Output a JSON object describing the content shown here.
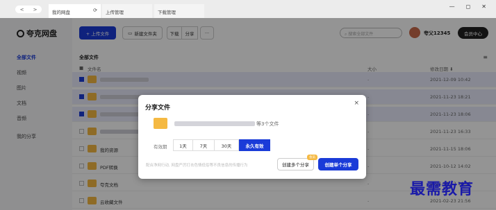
{
  "browser": {
    "nav": [
      "<",
      ">"
    ],
    "tabs": [
      "我的网盘",
      "上传管理",
      "下载管理"
    ],
    "refresh": "⟳",
    "window_controls": [
      "—",
      "◻",
      "✕"
    ]
  },
  "sidebar": {
    "logo": "夸克网盘",
    "items": [
      {
        "label": "全部文件",
        "active": true
      },
      {
        "label": "视频"
      },
      {
        "label": "图片"
      },
      {
        "label": "文档"
      },
      {
        "label": "音频"
      },
      {
        "label": "我的分享"
      }
    ]
  },
  "toolbar": {
    "upload": "+ 上传文件",
    "new_folder": "新建文件夹",
    "download": "下载",
    "share": "分享",
    "more": "···",
    "search_placeholder": "搜索全部文件",
    "username": "夸父12345",
    "vip": "会员中心"
  },
  "list": {
    "title": "全部文件",
    "view_icon": "≡",
    "columns": {
      "name": "文件名",
      "size": "大小",
      "date": "修改日期 ⬇"
    },
    "rows": [
      {
        "name": "",
        "size": "-",
        "date": "2021-12-09 10:42",
        "selected": true
      },
      {
        "name": "",
        "size": "-",
        "date": "2021-11-23 18:21",
        "selected": true
      },
      {
        "name": "",
        "size": "-",
        "date": "2021-11-23 18:06",
        "selected": true
      },
      {
        "name": "",
        "size": "-",
        "date": "2021-11-23 16:33",
        "selected": false
      },
      {
        "name": "我的资源",
        "size": "-",
        "date": "2021-11-15 18:06",
        "selected": false
      },
      {
        "name": "PDF转换",
        "size": "-",
        "date": "2021-10-12 14:02",
        "selected": false
      },
      {
        "name": "夸克文档",
        "size": "-",
        "date": "2021-10-12 14:06",
        "selected": false
      },
      {
        "name": "云收藏文件",
        "size": "-",
        "date": "2021-02-23 21:56",
        "selected": false
      }
    ]
  },
  "modal": {
    "title": "分享文件",
    "close": "×",
    "file_count": "等3个文件",
    "validity_label": "有效期",
    "durations": [
      "1天",
      "7天",
      "30天",
      "永久有效"
    ],
    "active_duration": "永久有效",
    "hint": "配合净网行动, 网盘严厉打击色情低俗等不良信息的传播行为",
    "btn_multi": "创建多个分享",
    "badge": "会员",
    "btn_single": "创建单个分享"
  },
  "watermark": "最需教育",
  "colors": {
    "accent": "#1a3bd8",
    "folder": "#f5b942",
    "selected_row": "#e8ebfc"
  }
}
